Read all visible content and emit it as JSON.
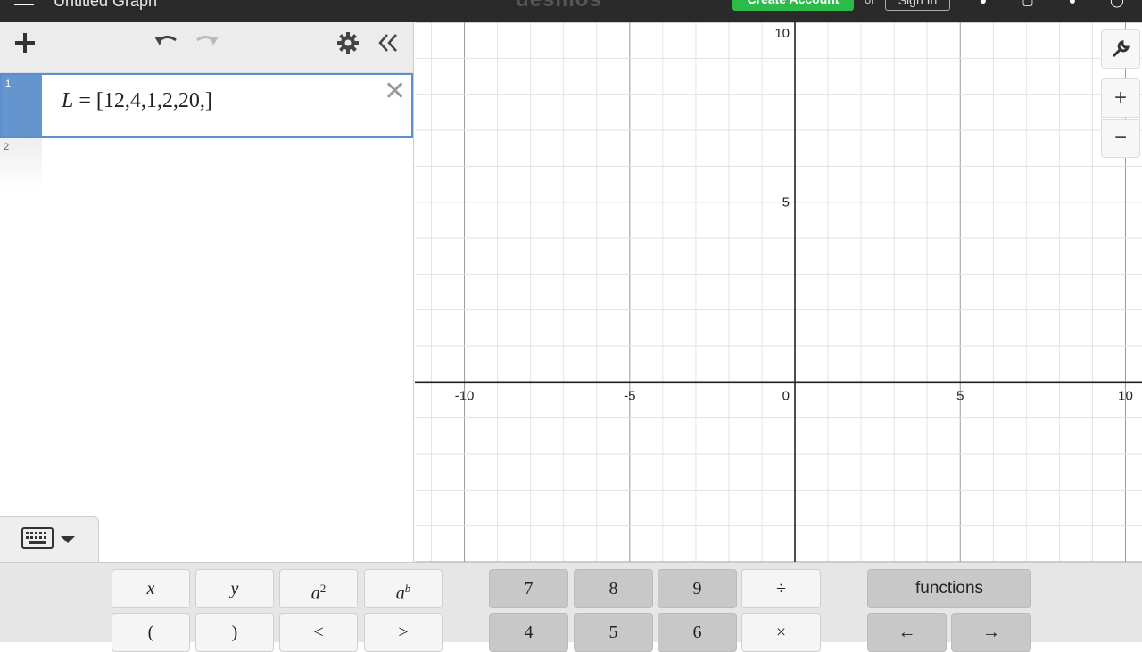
{
  "header": {
    "title": "Untitled Graph",
    "logo": "desmos",
    "create_account": "Create Account",
    "or": "or",
    "sign_in": "Sign In"
  },
  "expression_list": {
    "items": [
      {
        "number": "1",
        "latex_var": "L",
        "latex_rest": " = [12,4,1,2,20,]"
      },
      {
        "number": "2",
        "latex_var": "",
        "latex_rest": ""
      }
    ]
  },
  "graph": {
    "x_range": [
      -11.5,
      10.5
    ],
    "y_range": [
      -5,
      10
    ],
    "major_step": 5,
    "minor_step": 1,
    "x_tick_labels": [
      "-10",
      "-5",
      "0",
      "5",
      "10"
    ],
    "y_tick_labels": [
      "10",
      "5"
    ],
    "tools": {
      "zoom_in": "+",
      "zoom_out": "−"
    }
  },
  "keypad": {
    "keys_row1": [
      "x",
      "y",
      "a",
      "a",
      "7",
      "8",
      "9",
      "÷",
      "functions"
    ],
    "keys_row2": [
      "(",
      ")",
      "<",
      ">",
      "4",
      "5",
      "6",
      "×",
      "←",
      "→"
    ],
    "sup_2": "2",
    "sup_b": "b"
  },
  "colors": {
    "accent": "#6495cd",
    "topbar": "#2a2a2a",
    "create_button": "#2bbb4a"
  }
}
